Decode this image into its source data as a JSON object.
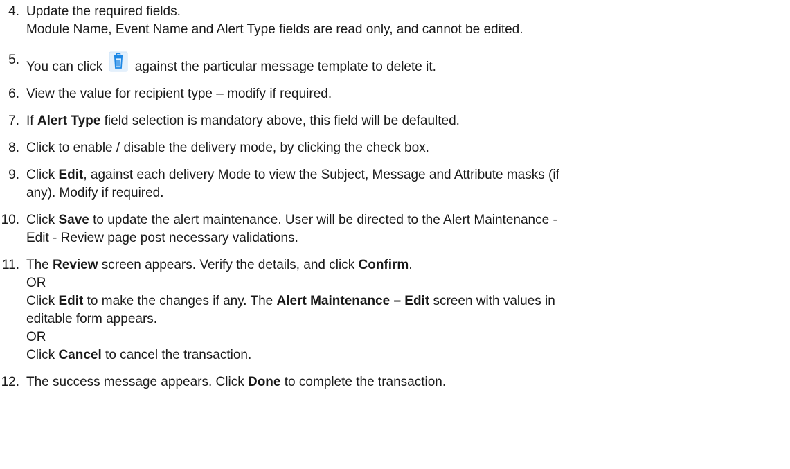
{
  "steps": [
    {
      "num": "4.",
      "line1": "Update the required fields.",
      "line2": "Module Name, Event Name and Alert Type fields are read only, and cannot be edited."
    },
    {
      "num": "5.",
      "pre": "You can click",
      "icon": "trash-icon",
      "post": "against the particular message template to delete it."
    },
    {
      "num": "6.",
      "text": "View the value for recipient type – modify if required."
    },
    {
      "num": "7.",
      "pre": "If ",
      "bold": "Alert Type",
      "post": " field selection is mandatory above, this field will be defaulted."
    },
    {
      "num": "8.",
      "text": "Click to enable / disable the delivery mode, by clicking the check box."
    },
    {
      "num": "9.",
      "pre": "Click ",
      "bold": "Edit",
      "post1": ", against each delivery Mode to view the Subject, Message and Attribute masks (if",
      "post2": "any). Modify if required."
    },
    {
      "num": "10.",
      "pre": "Click ",
      "bold": "Save",
      "post1": " to update the alert maintenance. User will be directed to the Alert Maintenance -",
      "post2": "Edit - Review page post necessary validations."
    },
    {
      "num": "11.",
      "a_pre": "The ",
      "a_bold1": "Review",
      "a_mid": " screen appears. Verify the details, and click ",
      "a_bold2": "Confirm",
      "a_post": ".",
      "or1": "OR",
      "b_pre": "Click ",
      "b_bold1": "Edit",
      "b_mid": " to make the changes if any. The ",
      "b_bold2": "Alert Maintenance – Edit",
      "b_post": " screen with values in",
      "b_line2": "editable form appears.",
      "or2": "OR",
      "c_pre": "Click ",
      "c_bold": "Cancel",
      "c_post": " to cancel the transaction."
    },
    {
      "num": "12.",
      "pre": "The success message appears. Click ",
      "bold": "Done",
      "post": " to complete the transaction."
    }
  ],
  "colors": {
    "text": "#1a1a1a",
    "icon_blue": "#1e88e5",
    "icon_bg": "#e3f0fc"
  }
}
